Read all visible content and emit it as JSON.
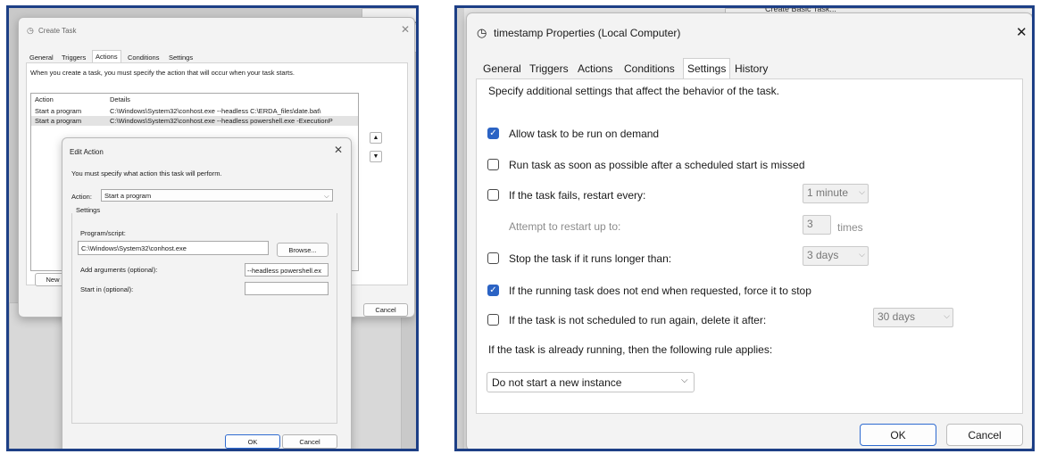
{
  "create_task": {
    "title": "Create Task",
    "tabs": [
      "General",
      "Triggers",
      "Actions",
      "Conditions",
      "Settings"
    ],
    "active_tab": "Actions",
    "instruction": "When you create a task, you must specify the action that will occur when your task starts.",
    "columns": [
      "Action",
      "Details"
    ],
    "rows": [
      {
        "action": "Start a program",
        "details": "C:\\Windows\\System32\\conhost.exe --headless C:\\ERDA_files\\date.bat\\"
      },
      {
        "action": "Start a program",
        "details": "C:\\Windows\\System32\\conhost.exe --headless powershell.exe -ExecutionP"
      }
    ],
    "new_button": "New",
    "cancel_button": "Cancel"
  },
  "edit_action": {
    "title": "Edit Action",
    "instruction": "You must specify what action this task will perform.",
    "action_label": "Action:",
    "action_value": "Start a program",
    "settings_label": "Settings",
    "program_label": "Program/script:",
    "program_value": "C:\\Windows\\System32\\conhost.exe",
    "browse_button": "Browse...",
    "args_label": "Add arguments (optional):",
    "args_value": "--headless powershell.ex",
    "start_in_label": "Start in (optional):",
    "start_in_value": "",
    "ok_button": "OK",
    "cancel_button": "Cancel"
  },
  "background": {
    "left_fragment": "de",
    "left_fragment2": "ol",
    "right_fragment": "Create Basic Task..."
  },
  "properties": {
    "title": "timestamp Properties (Local Computer)",
    "tabs": [
      "General",
      "Triggers",
      "Actions",
      "Conditions",
      "Settings",
      "History"
    ],
    "active_tab": "Settings",
    "intro": "Specify additional settings that affect the behavior of the task.",
    "allow_demand": {
      "label": "Allow task to be run on demand",
      "checked": true
    },
    "run_asap": {
      "label": "Run task as soon as possible after a scheduled start is missed",
      "checked": false
    },
    "restart": {
      "label": "If the task fails, restart every:",
      "checked": false,
      "interval": "1 minute"
    },
    "attempt": {
      "label": "Attempt to restart up to:",
      "value": "3",
      "unit": "times"
    },
    "stop_long": {
      "label": "Stop the task if it runs longer than:",
      "checked": false,
      "value": "3 days"
    },
    "force_stop": {
      "label": "If the running task does not end when requested, force it to stop",
      "checked": true
    },
    "delete_after": {
      "label": "If the task is not scheduled to run again, delete it after:",
      "checked": false,
      "value": "30 days"
    },
    "rule_label": "If the task is already running, then the following rule applies:",
    "rule_value": "Do not start a new instance",
    "ok_button": "OK",
    "cancel_button": "Cancel"
  },
  "colors": {
    "accent": "#2b63c4",
    "frame": "#1d3f86"
  }
}
